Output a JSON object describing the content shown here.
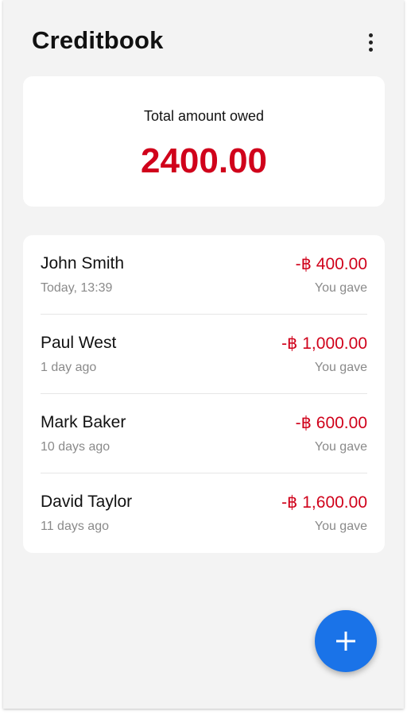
{
  "app": {
    "title": "Creditbook"
  },
  "summary": {
    "label": "Total amount owed",
    "amount": "2400.00",
    "amount_color": "#d0021b"
  },
  "entries": [
    {
      "name": "John Smith",
      "time": "Today, 13:39",
      "amount": "-฿ 400.00",
      "type": "You gave"
    },
    {
      "name": "Paul West",
      "time": "1 day ago",
      "amount": "-฿ 1,000.00",
      "type": "You gave"
    },
    {
      "name": "Mark Baker",
      "time": "10 days ago",
      "amount": "-฿ 600.00",
      "type": "You gave"
    },
    {
      "name": "David Taylor",
      "time": "11 days ago",
      "amount": "-฿ 1,600.00",
      "type": "You gave"
    }
  ],
  "icons": {
    "menu": "more-vert-icon",
    "fab": "plus-icon"
  },
  "colors": {
    "accent": "#1a73e8",
    "negative": "#d0021b",
    "background": "#f3f3f3"
  }
}
